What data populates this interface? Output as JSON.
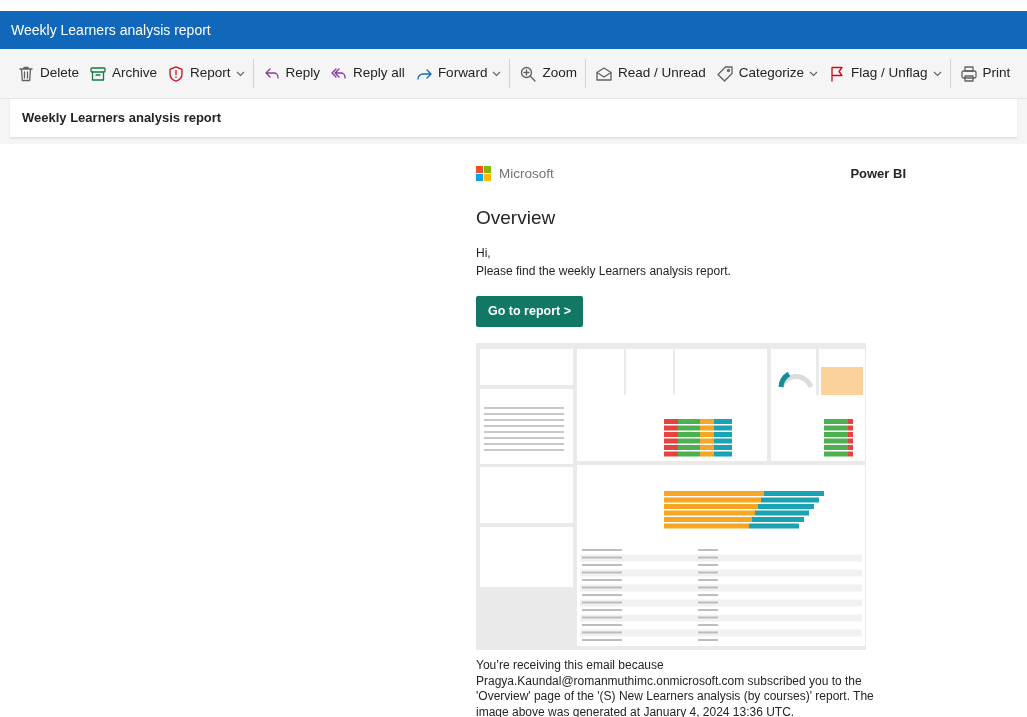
{
  "window": {
    "title": "Weekly Learners analysis report"
  },
  "toolbar": [
    {
      "kind": "delete",
      "label": "Delete",
      "has_menu": false,
      "group_end": false
    },
    {
      "kind": "archive",
      "label": "Archive",
      "has_menu": false,
      "group_end": false
    },
    {
      "kind": "report",
      "label": "Report",
      "has_menu": true,
      "group_end": true
    },
    {
      "kind": "reply",
      "label": "Reply",
      "has_menu": false,
      "group_end": false
    },
    {
      "kind": "replyall",
      "label": "Reply all",
      "has_menu": false,
      "group_end": false
    },
    {
      "kind": "forward",
      "label": "Forward",
      "has_menu": true,
      "group_end": true
    },
    {
      "kind": "zoom",
      "label": "Zoom",
      "has_menu": false,
      "group_end": true
    },
    {
      "kind": "read",
      "label": "Read / Unread",
      "has_menu": false,
      "group_end": false
    },
    {
      "kind": "tag",
      "label": "Categorize",
      "has_menu": true,
      "group_end": false
    },
    {
      "kind": "flag",
      "label": "Flag / Unflag",
      "has_menu": true,
      "group_end": true
    },
    {
      "kind": "print",
      "label": "Print",
      "has_menu": false,
      "group_end": false
    }
  ],
  "subject": "Weekly Learners analysis report",
  "email": {
    "brand": "Microsoft",
    "product": "Power BI",
    "heading": "Overview",
    "greeting": "Hi,",
    "message": "Please find the weekly Learners analysis report.",
    "button": "Go to report >",
    "footer": "You’re receiving this email because Pragya.Kaundal@romanmuthimc.onmicrosoft.com subscribed you to the 'Overview' page of the '(S) New Learners analysis (by courses)' report. The image above was generated at January 4, 2024 13:36 UTC."
  }
}
